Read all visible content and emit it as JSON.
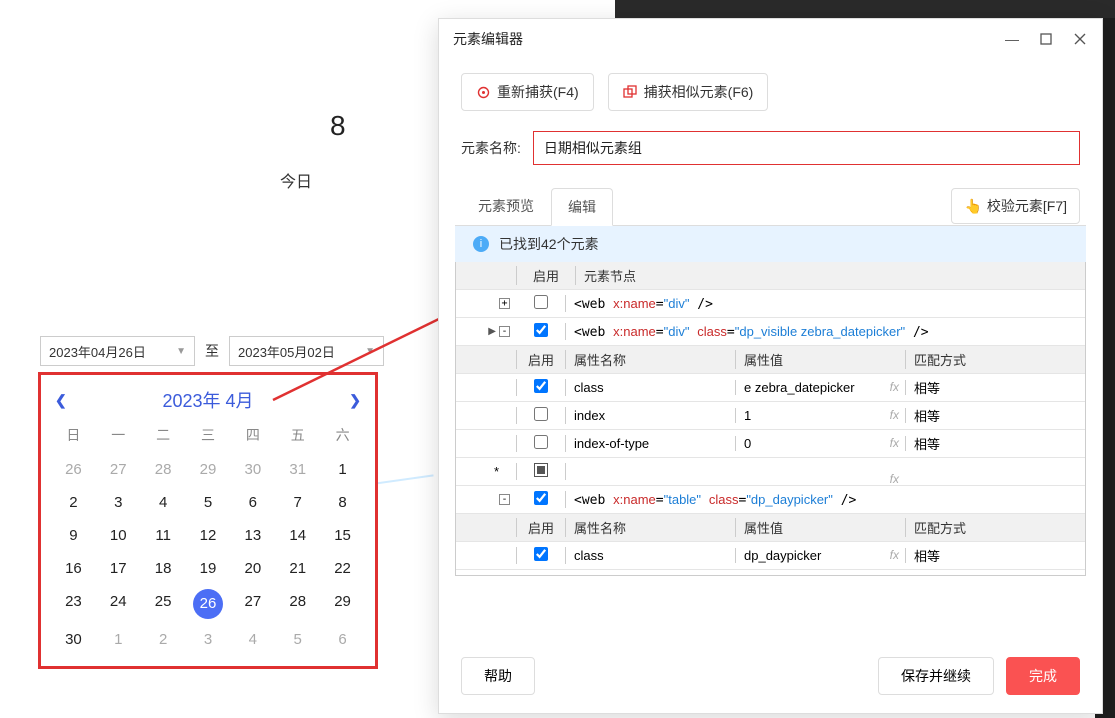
{
  "left": {
    "big": "8",
    "today": "今日",
    "date_from": "2023年04月26日",
    "to_label": "至",
    "date_to": "2023年05月02日"
  },
  "calendar": {
    "title": "2023年 4月",
    "weekdays": [
      "日",
      "一",
      "二",
      "三",
      "四",
      "五",
      "六"
    ],
    "days": [
      {
        "n": "26",
        "o": true
      },
      {
        "n": "27",
        "o": true
      },
      {
        "n": "28",
        "o": true
      },
      {
        "n": "29",
        "o": true
      },
      {
        "n": "30",
        "o": true
      },
      {
        "n": "31",
        "o": true
      },
      {
        "n": "1"
      },
      {
        "n": "2"
      },
      {
        "n": "3"
      },
      {
        "n": "4"
      },
      {
        "n": "5"
      },
      {
        "n": "6"
      },
      {
        "n": "7"
      },
      {
        "n": "8"
      },
      {
        "n": "9"
      },
      {
        "n": "10"
      },
      {
        "n": "11"
      },
      {
        "n": "12"
      },
      {
        "n": "13"
      },
      {
        "n": "14"
      },
      {
        "n": "15"
      },
      {
        "n": "16"
      },
      {
        "n": "17"
      },
      {
        "n": "18"
      },
      {
        "n": "19"
      },
      {
        "n": "20"
      },
      {
        "n": "21"
      },
      {
        "n": "22"
      },
      {
        "n": "23"
      },
      {
        "n": "24"
      },
      {
        "n": "25"
      },
      {
        "n": "26",
        "sel": true
      },
      {
        "n": "27"
      },
      {
        "n": "28"
      },
      {
        "n": "29"
      },
      {
        "n": "30"
      },
      {
        "n": "1",
        "o": true
      },
      {
        "n": "2",
        "o": true
      },
      {
        "n": "3",
        "o": true
      },
      {
        "n": "4",
        "o": true
      },
      {
        "n": "5",
        "o": true
      },
      {
        "n": "6",
        "o": true
      }
    ]
  },
  "editor": {
    "title": "元素编辑器",
    "recapture": "重新捕获(F4)",
    "capture_similar": "捕获相似元素(F6)",
    "name_label": "元素名称:",
    "name_value": "日期相似元素组",
    "tabs": {
      "preview": "元素预览",
      "edit": "编辑"
    },
    "verify": "校验元素[F7]",
    "info": "已找到42个元素",
    "node_hdr_enable": "启用",
    "node_hdr_node": "元素节点",
    "attr_hdr_enable": "启用",
    "attr_hdr_name": "属性名称",
    "attr_hdr_value": "属性值",
    "attr_hdr_match": "匹配方式",
    "nodes": [
      {
        "expand": "+",
        "checked": false,
        "code_name": "div",
        "code_attrs": ""
      },
      {
        "expand": "-",
        "active": true,
        "checked": true,
        "code_name": "div",
        "code_class": "dp_visible zebra_datepicker",
        "attrs": [
          {
            "checked": true,
            "name": "class",
            "value": "e zebra_datepicker",
            "match": "相等"
          },
          {
            "checked": false,
            "name": "index",
            "value": "1",
            "match": "相等"
          },
          {
            "checked": false,
            "name": "index-of-type",
            "value": "0",
            "match": "相等"
          },
          {
            "checked": "indet",
            "name": "",
            "value": "",
            "match": ""
          }
        ]
      },
      {
        "expand": "-",
        "checked": true,
        "code_name": "table",
        "code_class": "dp_daypicker",
        "attrs": [
          {
            "checked": true,
            "name": "class",
            "value": "dp_daypicker",
            "match": "相等"
          }
        ]
      }
    ],
    "footer": {
      "help": "帮助",
      "save": "保存并继续",
      "done": "完成"
    }
  }
}
